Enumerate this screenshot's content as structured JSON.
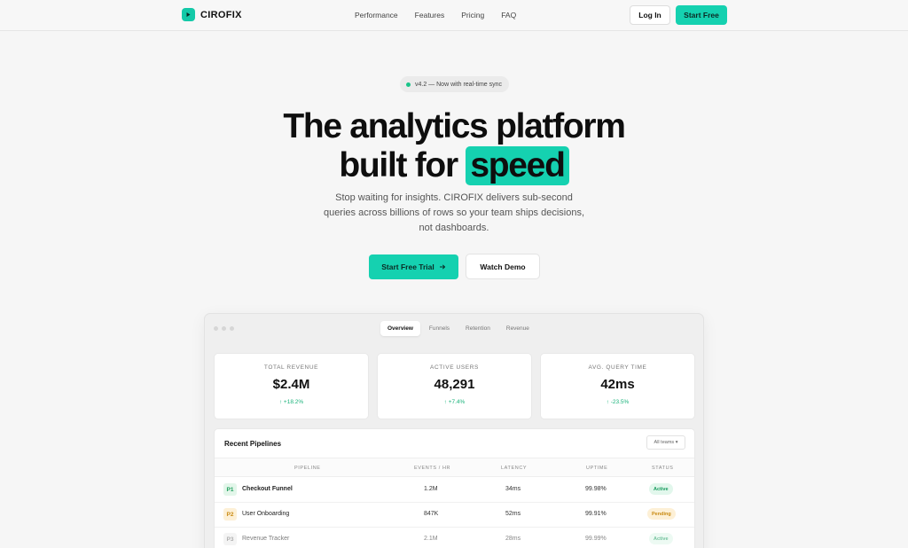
{
  "nav": {
    "logo_text": "CIROFIX",
    "links": [
      "Performance",
      "Features",
      "Pricing",
      "FAQ"
    ],
    "login_label": "Log In",
    "start_free_label": "Start Free"
  },
  "hero": {
    "badge_text": "v4.2 — Now with real-time sync",
    "headline_line1": "The analytics platform",
    "headline_line2_prefix": "built for",
    "headline_highlight": "speed",
    "subtext": "Stop waiting for insights. CIROFIX delivers sub-second queries across billions of rows so your team ships decisions, not dashboards.",
    "primary_cta": "Start Free Trial",
    "secondary_cta": "Watch Demo"
  },
  "dashboard": {
    "tabs": [
      "Overview",
      "Funnels",
      "Retention",
      "Revenue"
    ],
    "active_tab": "Overview",
    "kpis": [
      {
        "label": "TOTAL REVENUE",
        "value": "$2.4M",
        "delta": "+18.2%"
      },
      {
        "label": "ACTIVE USERS",
        "value": "48,291",
        "delta": "+7.4%"
      },
      {
        "label": "AVG. QUERY TIME",
        "value": "42ms",
        "delta": "-23.5%"
      }
    ],
    "pipelines": {
      "title": "Recent Pipelines",
      "filter_label": "All teams",
      "columns": [
        "PIPELINE",
        "EVENTS / HR",
        "LATENCY",
        "UPTIME",
        "STATUS"
      ],
      "rows": [
        {
          "priority": "P1",
          "name": "Checkout Funnel",
          "events": "1.2M",
          "latency": "34ms",
          "uptime": "99.98%",
          "status": "Active"
        },
        {
          "priority": "P2",
          "name": "User Onboarding",
          "events": "847K",
          "latency": "52ms",
          "uptime": "99.91%",
          "status": "Pending"
        },
        {
          "priority": "P3",
          "name": "Revenue Tracker",
          "events": "2.1M",
          "latency": "28ms",
          "uptime": "99.99%",
          "status": "Active"
        }
      ]
    }
  },
  "colors": {
    "accent": "#15d1b0",
    "positive": "#19b27a",
    "active_badge_bg": "#e2f7ec",
    "pending_badge_bg": "#fdf0d6"
  }
}
